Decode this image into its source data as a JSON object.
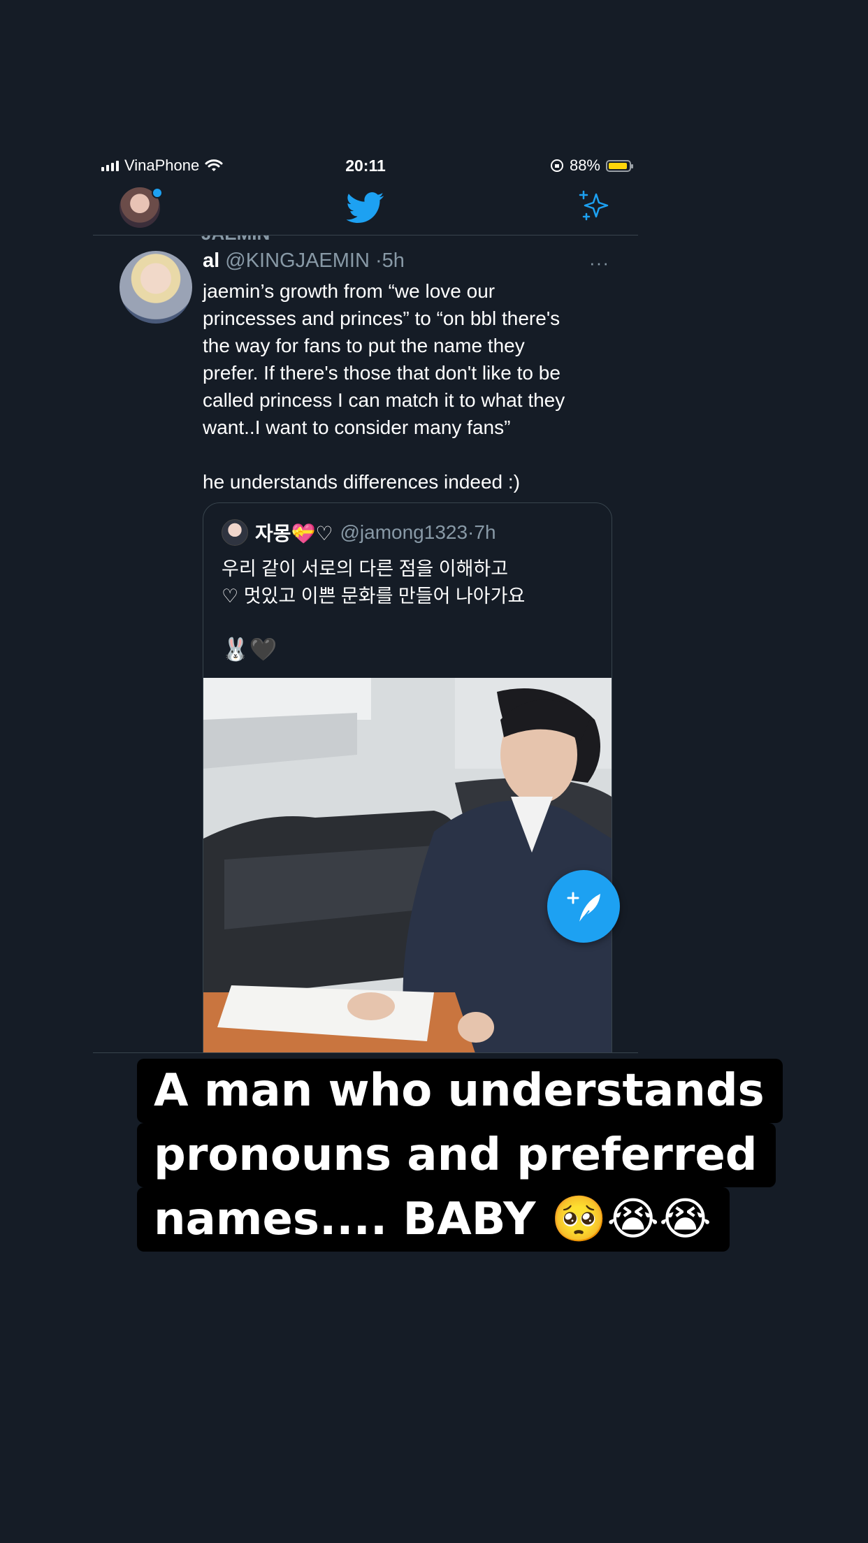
{
  "status_bar": {
    "carrier": "VinaPhone",
    "time": "20:11",
    "battery": "88%",
    "battery_color": "#ffd60a"
  },
  "nav": {
    "logo_icon": "twitter-bird-icon",
    "sparkle_icon": "sparkle-icon",
    "accent": "#1da1f2"
  },
  "feed": {
    "cut_text": "JAEMIN",
    "tweet": {
      "name": "al",
      "handle": "@KINGJAEMIN",
      "time": "5h",
      "more": "···",
      "text": "jaemin’s growth from “we love our\nprincesses and princes” to “on bbl there's\nthe way for fans to put the name they\nprefer. If there's those that don't like to be\ncalled princess I can match it to what they\nwant..I want to consider many fans”\n\nhe understands differences indeed :)"
    },
    "quote": {
      "name": "자몽💝♡",
      "handle": "@jamong1323",
      "time": "7h",
      "text": "우리 같이 서로의 다른 점을 이해하고\n♡ 멋있고 이쁜 문화를 만들어 나아가요",
      "emoji": "🐰🖤"
    }
  },
  "caption": {
    "line1": "A man who understands",
    "line2": "pronouns and preferred",
    "line3": "names.... BABY 🥺😭😭"
  }
}
